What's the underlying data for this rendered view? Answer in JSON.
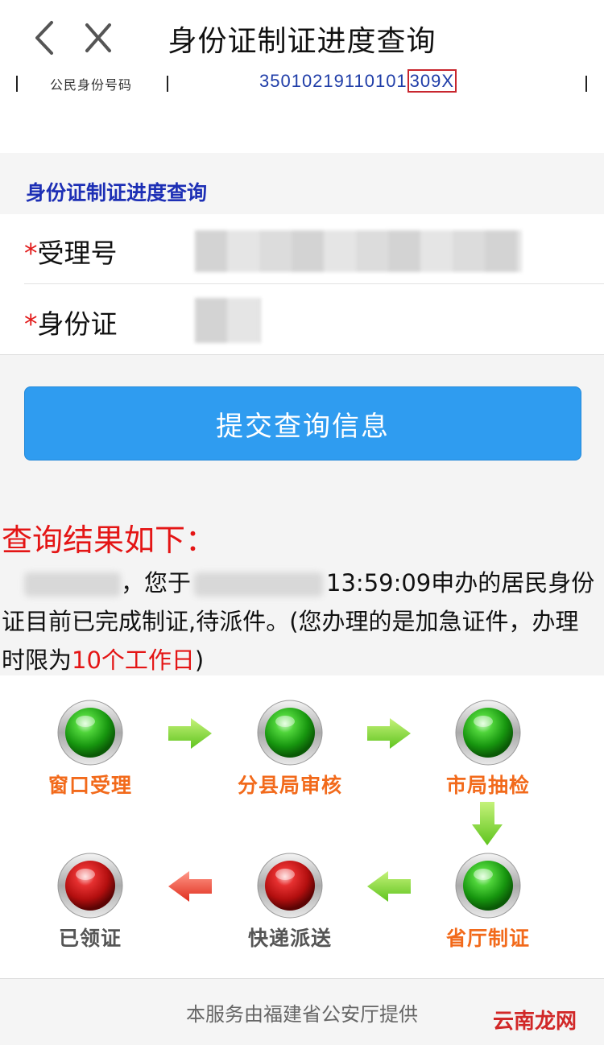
{
  "nav": {
    "title": "身份证制证进度查询"
  },
  "doc_strip": {
    "label": "公民身份号码",
    "number_prefix": "35010219110101",
    "number_highlight": "309X"
  },
  "section": {
    "title": "身份证制证进度查询"
  },
  "form": {
    "receipt": {
      "label": "受理号",
      "required_mark": "*"
    },
    "idcard": {
      "label": "身份证",
      "required_mark": "*"
    }
  },
  "submit_label": "提交查询信息",
  "result": {
    "title": "查询结果如下：",
    "part1": "，您于",
    "part2": "13:59:09申办的居民身份证目前已完成制证,待派件。(您办理的是加急证件，办理时限为",
    "highlight": "10个工作日",
    "part3": ")"
  },
  "flow": {
    "steps": [
      {
        "label": "窗口受理",
        "status": "done",
        "color": "#25a81a"
      },
      {
        "label": "分县局审核",
        "status": "done",
        "color": "#25a81a"
      },
      {
        "label": "市局抽检",
        "status": "done",
        "color": "#25a81a"
      },
      {
        "label": "省厅制证",
        "status": "done",
        "color": "#25a81a"
      },
      {
        "label": "快递派送",
        "status": "pending",
        "color": "#cc1414"
      },
      {
        "label": "已领证",
        "status": "pending",
        "color": "#cc1414"
      }
    ]
  },
  "footer": {
    "text": "本服务由福建省公安厅提供",
    "watermark": "云南龙网"
  }
}
